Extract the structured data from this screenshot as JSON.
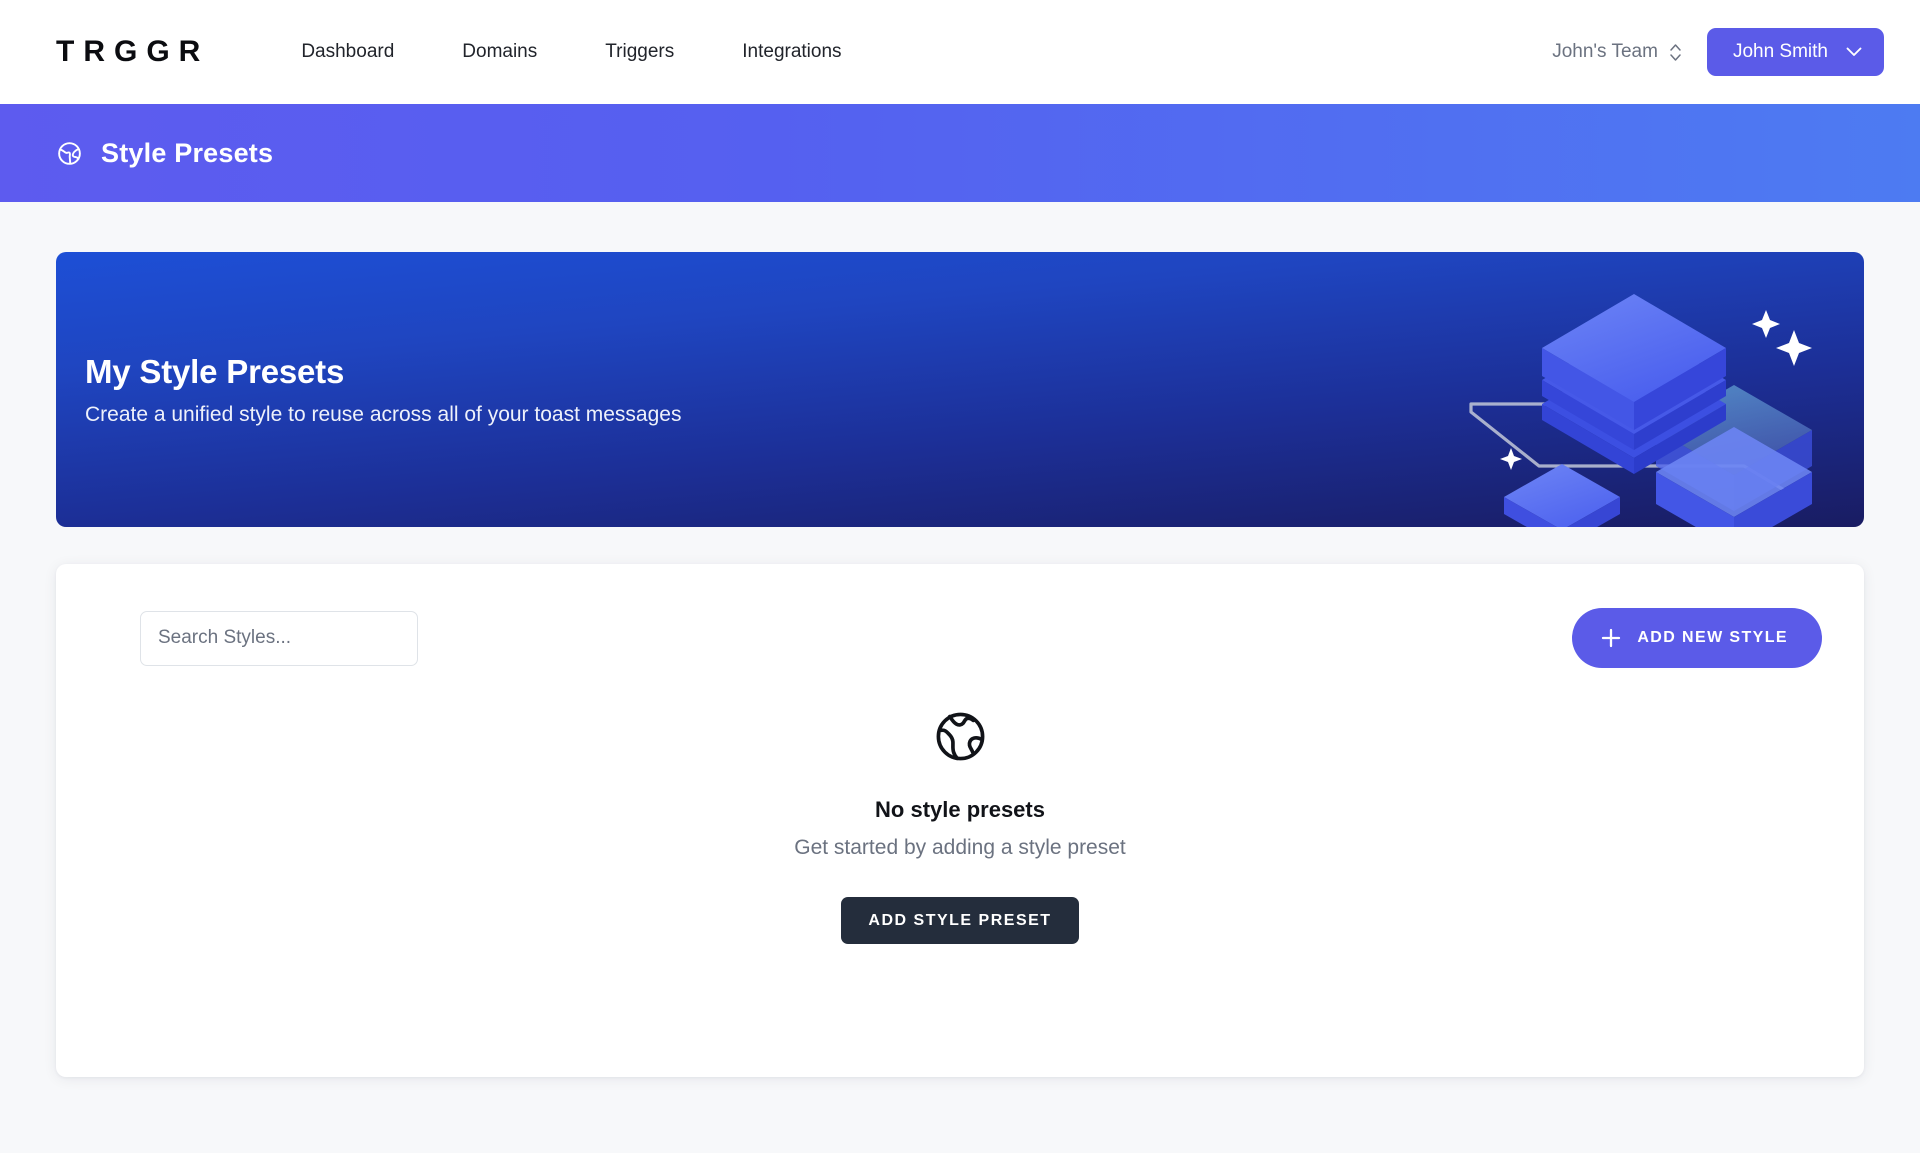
{
  "header": {
    "logo": "TRGGR",
    "nav": [
      {
        "label": "Dashboard"
      },
      {
        "label": "Domains"
      },
      {
        "label": "Triggers"
      },
      {
        "label": "Integrations"
      }
    ],
    "team_name": "John's Team",
    "team_switcher_icon": "chevron-up-down-icon",
    "user_name": "John Smith",
    "user_chevron_icon": "chevron-down-icon",
    "user_button_color": "#5b5be8"
  },
  "page_band": {
    "icon": "globe-icon",
    "title": "Style Presets",
    "gradient_from": "#5d5bef",
    "gradient_to": "#4d7bf2"
  },
  "hero": {
    "title": "My Style Presets",
    "subtitle": "Create a unified style to reuse across all of your toast messages",
    "gradient_from": "#1d4fd6",
    "gradient_to": "#191c62",
    "artwork": "isometric-blocks-illustration"
  },
  "toolbar": {
    "search_placeholder": "Search Styles...",
    "search_value": "",
    "add_new_label": "ADD NEW STYLE",
    "add_new_icon": "plus-icon",
    "add_new_color": "#5b5be8"
  },
  "empty_state": {
    "icon": "globe-icon",
    "title": "No style presets",
    "subtitle": "Get started by adding a style preset",
    "button_label": "ADD STYLE PRESET",
    "button_color": "#242d3c"
  }
}
